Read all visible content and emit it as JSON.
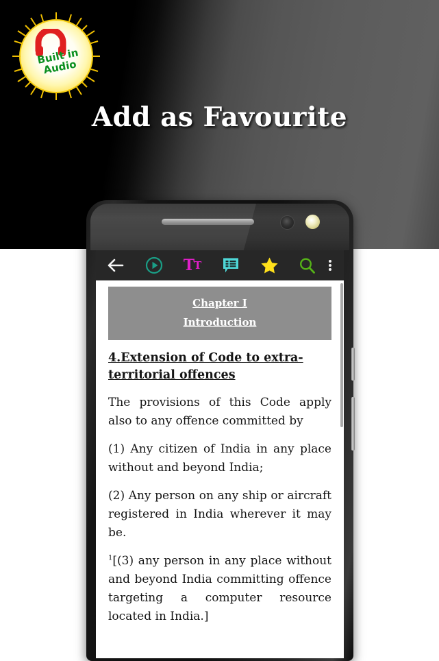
{
  "promo": {
    "headline": "Add as Favourite",
    "badge": {
      "line1": "Built in",
      "line2": "Audio",
      "icon": "headphones-icon"
    }
  },
  "toolbar": {
    "back_label": "Back",
    "play_label": "Play audio",
    "text_size_big": "T",
    "text_size_small": "T",
    "notes_label": "Notes",
    "favourite_label": "Favourite",
    "search_label": "Search",
    "overflow_label": "More options",
    "background_color": "#272727",
    "colors": {
      "back": "#f5f5f5",
      "play": "#1a9e86",
      "text_size": "#e01fc8",
      "notes": "#4fd8d8",
      "favourite": "#ffe01b",
      "search": "#55b217",
      "overflow": "#f2f2f2"
    }
  },
  "document": {
    "chapter_title": "Chapter I",
    "chapter_subtitle": "Introduction",
    "section_heading": "4.Extension of Code to extra-territorial offences",
    "paragraphs": [
      "The provisions of this Code apply also to any offence committed by",
      "(1) Any citizen of India in any place without and beyond India;",
      "(2) Any person on any ship or aircraft registered in India wherever it may be."
    ],
    "footnote_marker": "1",
    "last_paragraph": "[(3) any person in any place without and beyond India committing offence targeting a computer resource located in India.]"
  }
}
